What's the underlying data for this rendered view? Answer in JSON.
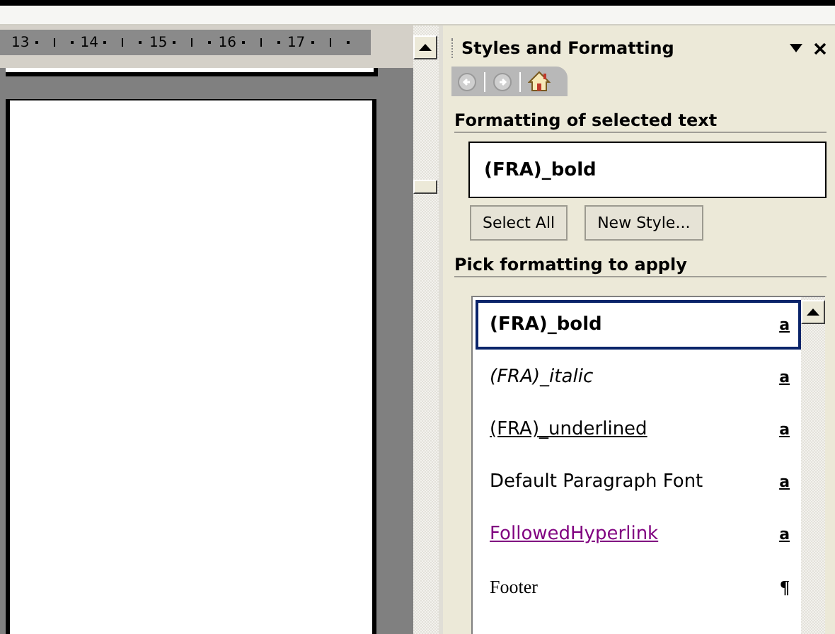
{
  "ruler": {
    "numbers": [
      "13",
      "14",
      "15",
      "16",
      "17"
    ]
  },
  "panel": {
    "title": "Styles and Formatting",
    "selected_section": {
      "heading": "Formatting of selected text",
      "value": "(FRA)_bold"
    },
    "buttons": [
      "Select All",
      "New Style..."
    ],
    "pick_section": {
      "heading": "Pick formatting to apply"
    },
    "styles": [
      {
        "name": "(FRA)_bold",
        "kind": "character",
        "indicator": "a",
        "bold": true,
        "italic": false,
        "underline": false,
        "selected": true
      },
      {
        "name": "(FRA)_italic",
        "kind": "character",
        "indicator": "a",
        "bold": false,
        "italic": true,
        "underline": false,
        "selected": false
      },
      {
        "name": "(FRA)_underlined",
        "kind": "character",
        "indicator": "a",
        "bold": false,
        "italic": false,
        "underline": true,
        "selected": false
      },
      {
        "name": "Default Paragraph Font",
        "kind": "character",
        "indicator": "a",
        "bold": false,
        "italic": false,
        "underline": false,
        "selected": false
      },
      {
        "name": "FollowedHyperlink",
        "kind": "character",
        "indicator": "a",
        "bold": false,
        "italic": false,
        "underline": true,
        "color": "#800080",
        "selected": false
      },
      {
        "name": "Footer",
        "kind": "paragraph",
        "indicator": "¶",
        "bold": false,
        "italic": false,
        "underline": false,
        "selected": false
      }
    ]
  }
}
